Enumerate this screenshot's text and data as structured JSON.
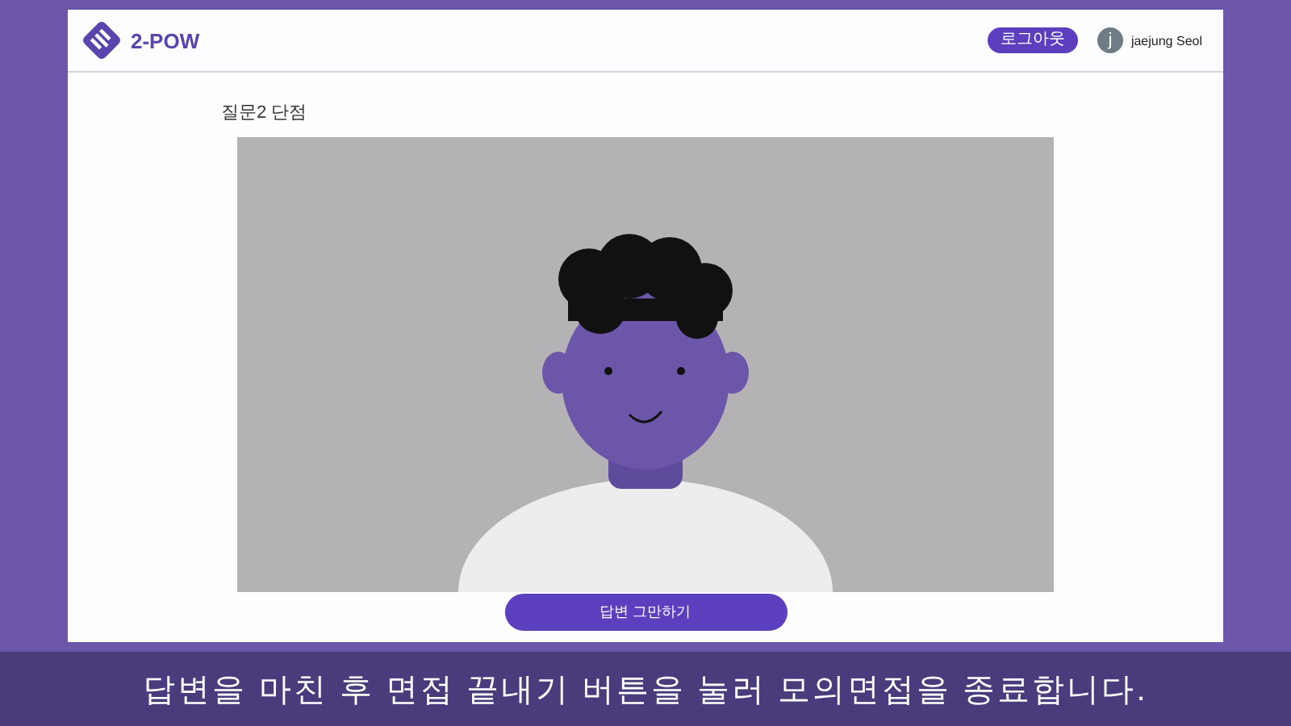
{
  "header": {
    "logo": "2-POW",
    "logout_button": "로그아웃",
    "user": {
      "initial": "j",
      "name": "jaejung Seol"
    }
  },
  "question": {
    "title": "질문2 단점"
  },
  "stop_button": "답변 그만하기",
  "caption": "답변을 마친 후 면접 끝내기 버튼을 눌러 모의면접을 종료합니다."
}
